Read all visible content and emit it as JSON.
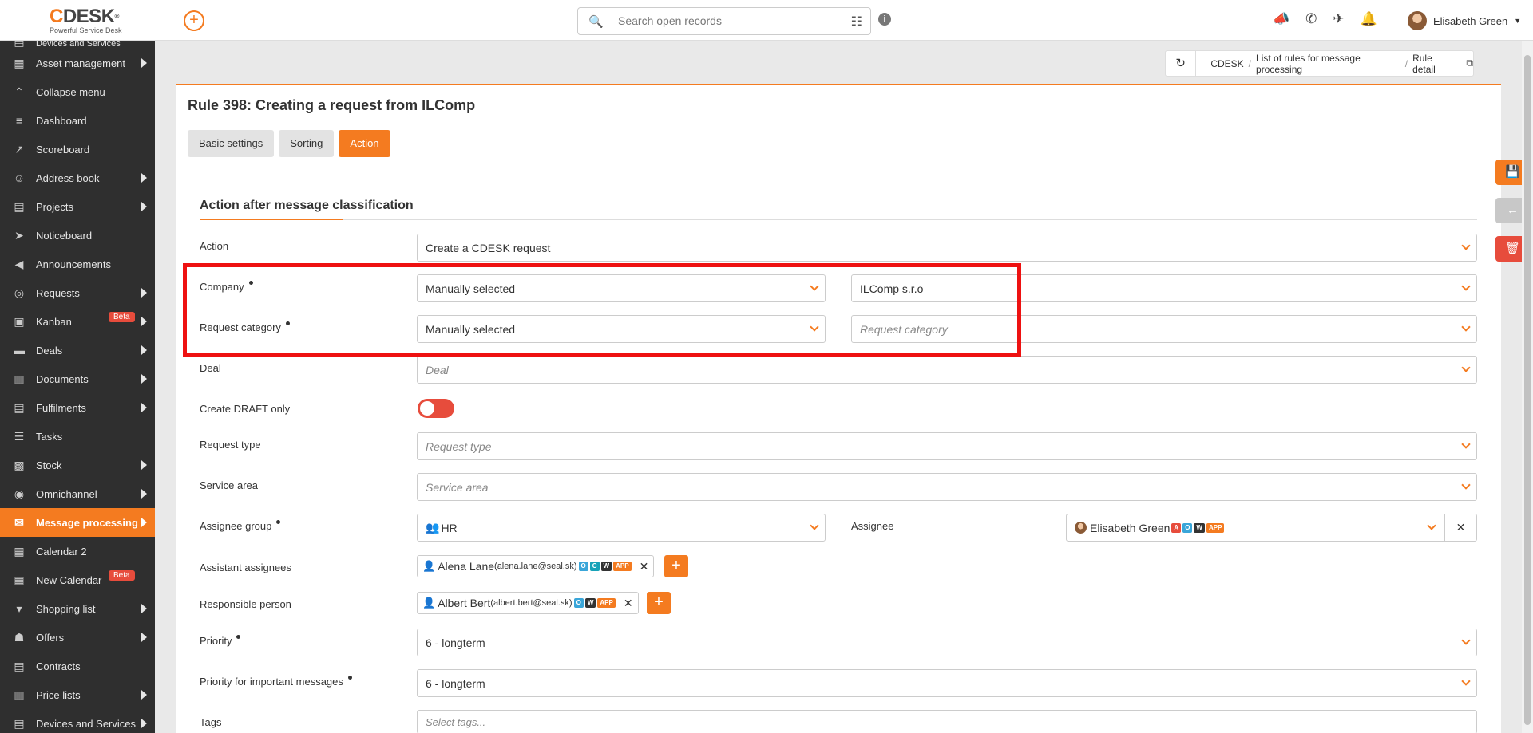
{
  "logo": {
    "brand_c": "C",
    "brand_rest": "DESK",
    "reg": "®",
    "tagline": "Powerful Service Desk"
  },
  "search": {
    "placeholder": "Search open records"
  },
  "user": {
    "name": "Elisabeth Green"
  },
  "sidebar": {
    "items": [
      {
        "label": "Devices and Services",
        "icon": "folder-icon",
        "arrow": true
      },
      {
        "label": "Asset management",
        "icon": "asset-icon",
        "arrow": true
      },
      {
        "label": "Collapse menu",
        "icon": "collapse-icon",
        "arrow": false
      },
      {
        "label": "Dashboard",
        "icon": "dashboard-icon",
        "arrow": false
      },
      {
        "label": "Scoreboard",
        "icon": "chart-icon",
        "arrow": false
      },
      {
        "label": "Address book",
        "icon": "user-icon",
        "arrow": true
      },
      {
        "label": "Projects",
        "icon": "folder-icon",
        "arrow": true
      },
      {
        "label": "Noticeboard",
        "icon": "paper-plane-icon",
        "arrow": false
      },
      {
        "label": "Announcements",
        "icon": "megaphone-icon",
        "arrow": false
      },
      {
        "label": "Requests",
        "icon": "requests-icon",
        "arrow": true
      },
      {
        "label": "Kanban",
        "icon": "kanban-icon",
        "arrow": true,
        "badge": "Beta"
      },
      {
        "label": "Deals",
        "icon": "deals-icon",
        "arrow": true
      },
      {
        "label": "Documents",
        "icon": "documents-icon",
        "arrow": true
      },
      {
        "label": "Fulfilments",
        "icon": "fulfilments-icon",
        "arrow": true
      },
      {
        "label": "Tasks",
        "icon": "tasks-icon",
        "arrow": false
      },
      {
        "label": "Stock",
        "icon": "stock-icon",
        "arrow": true
      },
      {
        "label": "Omnichannel",
        "icon": "omnichannel-icon",
        "arrow": true
      },
      {
        "label": "Message processing",
        "icon": "envelope-icon",
        "arrow": true,
        "active": true
      },
      {
        "label": "Calendar 2",
        "icon": "calendar-icon",
        "arrow": false
      },
      {
        "label": "New Calendar",
        "icon": "calendar-icon",
        "arrow": false,
        "badge": "Beta"
      },
      {
        "label": "Shopping list",
        "icon": "cart-icon",
        "arrow": true
      },
      {
        "label": "Offers",
        "icon": "gift-icon",
        "arrow": true
      },
      {
        "label": "Contracts",
        "icon": "contract-icon",
        "arrow": false
      },
      {
        "label": "Price lists",
        "icon": "price-icon",
        "arrow": true
      },
      {
        "label": "Devices and Services",
        "icon": "folder-icon",
        "arrow": true
      }
    ]
  },
  "breadcrumb": {
    "items": [
      "CDESK",
      "List of rules for message processing",
      "Rule detail"
    ]
  },
  "page": {
    "title": "Rule 398: Creating a request from ILComp"
  },
  "tabs": [
    "Basic settings",
    "Sorting",
    "Action"
  ],
  "section": {
    "title": "Action after message classification"
  },
  "form": {
    "action": {
      "label": "Action",
      "value": "Create a CDESK request"
    },
    "company": {
      "label": "Company",
      "mode": "Manually selected",
      "value": "ILComp s.r.o"
    },
    "request_category": {
      "label": "Request category",
      "mode": "Manually selected",
      "placeholder": "Request category"
    },
    "deal": {
      "label": "Deal",
      "placeholder": "Deal"
    },
    "draft": {
      "label": "Create DRAFT only",
      "enabled": false
    },
    "request_type": {
      "label": "Request type",
      "placeholder": "Request type"
    },
    "service_area": {
      "label": "Service area",
      "placeholder": "Service area"
    },
    "assignee_group": {
      "label": "Assignee group",
      "value": "HR"
    },
    "assignee": {
      "label": "Assignee",
      "value": "Elisabeth Green",
      "badges": [
        "A",
        "O",
        "W",
        "APP"
      ]
    },
    "assistant_assignees": {
      "label": "Assistant assignees",
      "name": "Alena Lane",
      "email": "(alena.lane@seal.sk)",
      "badges": [
        "O",
        "C",
        "W",
        "APP"
      ]
    },
    "responsible_person": {
      "label": "Responsible person",
      "name": "Albert Bert",
      "email": "(albert.bert@seal.sk)",
      "badges": [
        "O",
        "W",
        "APP"
      ]
    },
    "priority": {
      "label": "Priority",
      "value": "6 - longterm"
    },
    "priority_important": {
      "label": "Priority for important messages",
      "value": "6 - longterm"
    },
    "tags": {
      "label": "Tags",
      "placeholder": "Select tags..."
    }
  },
  "colors": {
    "accent": "#f47b20",
    "sidebar_bg": "#2f2f2f",
    "delete": "#e74c3c",
    "highlight": "#ee1111"
  }
}
